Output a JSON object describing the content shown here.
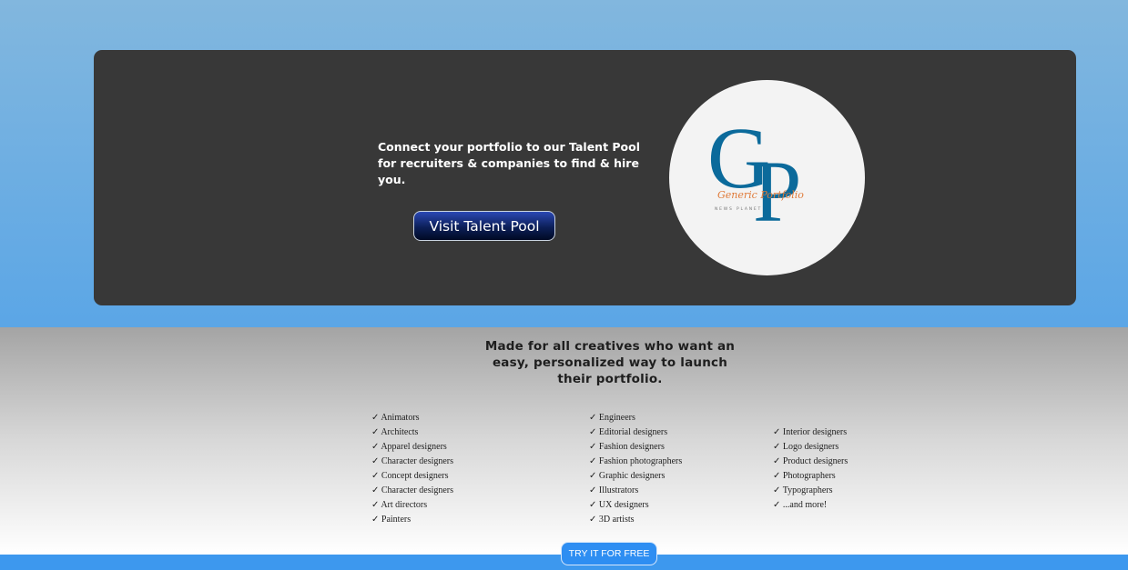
{
  "hero": {
    "description": "Connect your portfolio to our Talent Pool for recruiters & companies to find & hire you.",
    "button_label": "Visit Talent Pool",
    "logo": {
      "monogram": "GP",
      "script_text": "Generic Portfolio",
      "tagline": "NEWS PLANET",
      "primary_color": "#0b6a9b",
      "accent_color": "#e07b3a"
    }
  },
  "features": {
    "heading": "Made for all creatives who want an easy, personalized way to launch their portfolio.",
    "check_symbol": "✓",
    "columns": [
      [
        "Animators",
        "Architects",
        "Apparel designers",
        "Character designers",
        "Concept designers",
        "Character designers",
        "Art directors",
        "Painters"
      ],
      [
        "Engineers",
        "Editorial designers",
        "Fashion designers",
        "Fashion photographers",
        "Graphic designers",
        "Illustrators",
        "UX designers",
        "3D artists"
      ],
      [
        "Interior designers",
        "Logo designers",
        "Product designers",
        "Photographers",
        "Typographers",
        "...and more!"
      ]
    ]
  },
  "cta": {
    "button_label": "TRY IT FOR FREE",
    "color": "#2e8ef2"
  }
}
